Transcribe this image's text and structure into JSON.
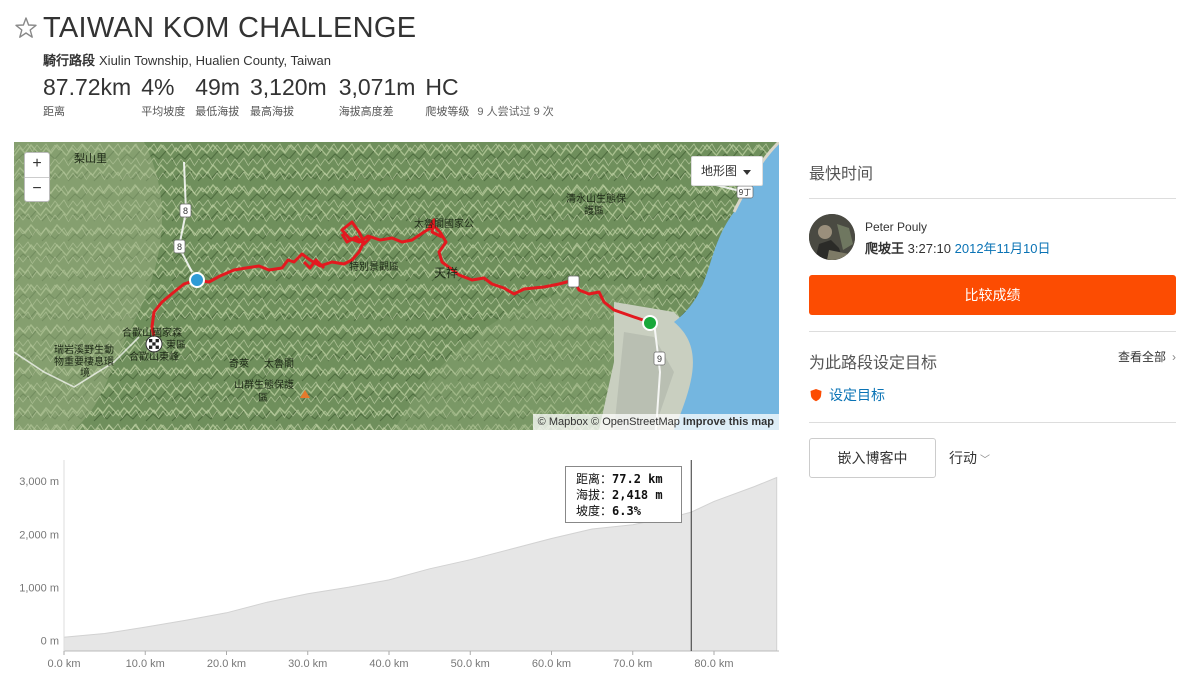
{
  "header": {
    "title": "TAIWAN KOM CHALLENGE",
    "segment_type": "騎行路段",
    "location": "Xiulin Township, Hualien County, Taiwan"
  },
  "stats": [
    {
      "value": "87.72km",
      "label": "距离"
    },
    {
      "value": "4%",
      "label": "平均坡度"
    },
    {
      "value": "49m",
      "label": "最低海拔"
    },
    {
      "value": "3,120m",
      "label": "最高海拔"
    },
    {
      "value": "3,071m",
      "label": "海拔高度差"
    },
    {
      "value": "HC",
      "label": "爬坡等级",
      "extra": "9 人尝试过 9 次"
    }
  ],
  "map": {
    "zoom_in": "+",
    "zoom_out": "−",
    "map_type": "地形图",
    "attribution": {
      "mapbox": "© Mapbox",
      "osm": "© OpenStreetMap",
      "improve": "Improve this map"
    },
    "labels": {
      "lishan": "梨山里",
      "hehuan_forest": "合歡山國家森",
      "east_area": "東區",
      "wildlife_1": "瑞岩溪野生動",
      "wildlife_2": "物重要棲息環",
      "wildlife_3": "境",
      "hehuan_east": "合歡山東峰",
      "taroko_park": "太魯閣國家公",
      "tianxiang": "天祥",
      "special_scenic": "特別景觀區",
      "qingshui_1": "清水山生態保",
      "qingshui_2": "護區",
      "taroko_eco_1": "太魯閣",
      "taroko_eco_2": "山群生態保護",
      "taroko_eco_3": "區",
      "qi": "奇萊",
      "road_8a": "8",
      "road_8b": "8",
      "road_9t": "9丁",
      "road_9": "9"
    },
    "colors": {
      "route": "#e3191f",
      "start": "#18a83a",
      "end_marker": "#2e9bd6",
      "sea": "#74b6e0"
    }
  },
  "elevation": {
    "y_ticks": [
      "3,000 m",
      "2,000 m",
      "1,000 m",
      "0 m"
    ],
    "x_ticks": [
      "0.0 km",
      "10.0 km",
      "20.0 km",
      "30.0 km",
      "40.0 km",
      "50.0 km",
      "60.0 km",
      "70.0 km",
      "80.0 km"
    ],
    "tooltip": {
      "distance_label": "距离：",
      "distance_value": "77.2 km",
      "elev_label": "海拔：",
      "elev_value": "2,418 m",
      "grade_label": "坡度：",
      "grade_value": "6.3%"
    }
  },
  "chart_data": {
    "type": "area",
    "x": [
      0,
      5,
      10,
      15,
      20,
      25,
      30,
      35,
      40,
      45,
      50,
      55,
      60,
      65,
      70,
      75,
      77.2,
      80,
      85,
      87.72
    ],
    "y": [
      60,
      130,
      250,
      380,
      520,
      720,
      880,
      1000,
      1140,
      1350,
      1520,
      1720,
      1920,
      2100,
      2180,
      2330,
      2418,
      2620,
      2900,
      3070
    ],
    "xlim": [
      0,
      88
    ],
    "ylim": [
      -200,
      3400
    ],
    "y_unit": "m",
    "x_unit": "km",
    "cursor_x": 77.2,
    "fill_color": "#e6e6e6"
  },
  "leaderboard": {
    "heading": "最快时间",
    "athlete": "Peter Pouly",
    "kom_label": "爬坡王",
    "time": "3:27:10",
    "date": "2012年11月10日",
    "compare_button": "比较成绩"
  },
  "goals": {
    "heading": "为此路段设定目标",
    "view_all": "查看全部",
    "set_goal": "设定目标"
  },
  "footer": {
    "embed_button": "嵌入博客中",
    "actions": "行动"
  }
}
